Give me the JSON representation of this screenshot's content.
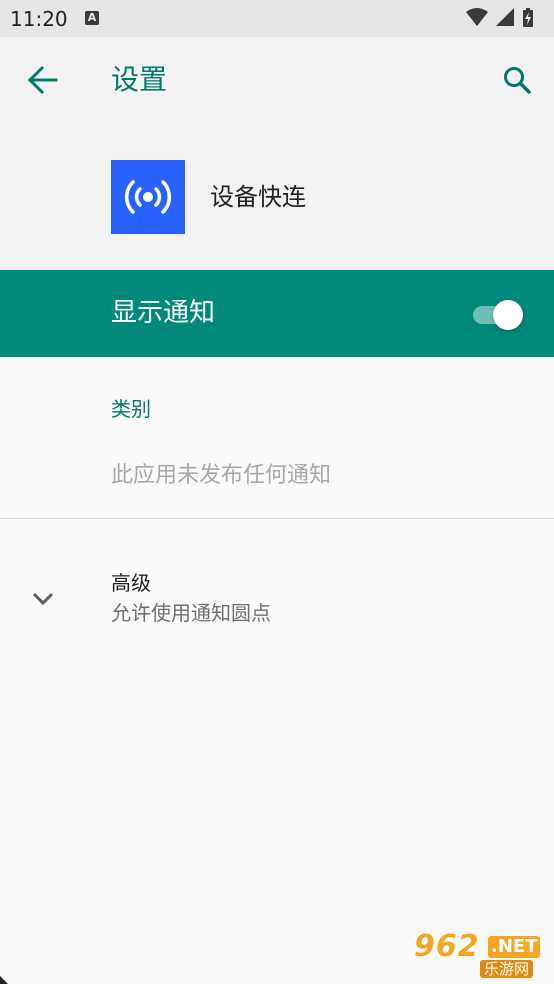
{
  "status_bar": {
    "time": "11:20",
    "notification_icon": "A",
    "icons": [
      "wifi-icon",
      "cell-signal-icon",
      "battery-charging-icon"
    ]
  },
  "app_bar": {
    "title": "设置",
    "back_icon": "arrow-left-icon",
    "search_icon": "search-icon"
  },
  "app_info": {
    "name": "设备快连",
    "icon": "broadcast-icon",
    "icon_color": "#2962ff"
  },
  "master_switch": {
    "label": "显示通知",
    "state": "on",
    "color": "#00897b"
  },
  "categories": {
    "header": "类别",
    "empty_message": "此应用未发布任何通知"
  },
  "advanced": {
    "title": "高级",
    "summary": "允许使用通知圆点",
    "icon": "chevron-down-icon"
  },
  "watermark": {
    "brand_number": "962",
    "brand_suffix": ".NET",
    "brand_text": "乐游网"
  },
  "colors": {
    "accent": "#00796b",
    "switch_bar": "#00897b",
    "background": "#fafafa"
  }
}
